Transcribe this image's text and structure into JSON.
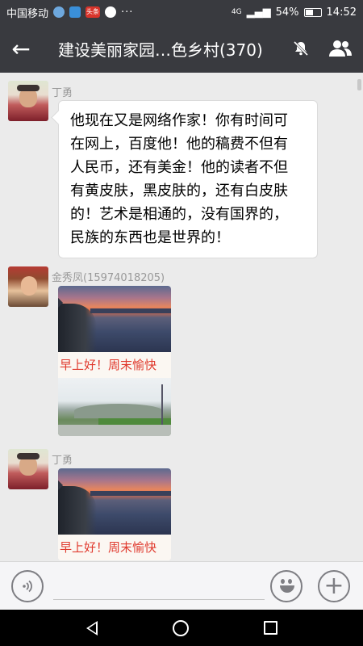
{
  "status_bar": {
    "carrier": "中国移动",
    "news_badge": "头条",
    "dots": "···",
    "network": "4G",
    "battery_percent": "54%",
    "battery_level": 0.54,
    "time": "14:52"
  },
  "header": {
    "title": "建设美丽家园…色乡村(370)",
    "back_icon": "back-arrow-icon",
    "mute_icon": "bell-off-icon",
    "members_icon": "group-members-icon"
  },
  "messages": [
    {
      "sender": "丁勇",
      "type": "text",
      "lines": [
        "他现在又是网络作家！你有时间可",
        "在网上，百度他！他的稿费不但有",
        "人民币，还有美金！他的读者不但",
        "有黄皮肤，黑皮肤的，还有白皮肤",
        "的！艺术是相通的，没有国界的，",
        "民族的东西也是世界的！"
      ]
    },
    {
      "sender": "金秀凤(15974018205)",
      "type": "image",
      "caption": "早上好！周末愉快"
    },
    {
      "sender": "丁勇",
      "type": "image",
      "caption": "早上好！周末愉快"
    }
  ],
  "input_bar": {
    "voice_icon": "voice-icon",
    "emoji_icon": "emoji-icon",
    "plus_icon": "plus-icon",
    "plus_label": "+"
  },
  "colors": {
    "bar_dark": "#393a3f",
    "chat_bg": "#ebebeb",
    "caption_red": "#e03a2e"
  }
}
